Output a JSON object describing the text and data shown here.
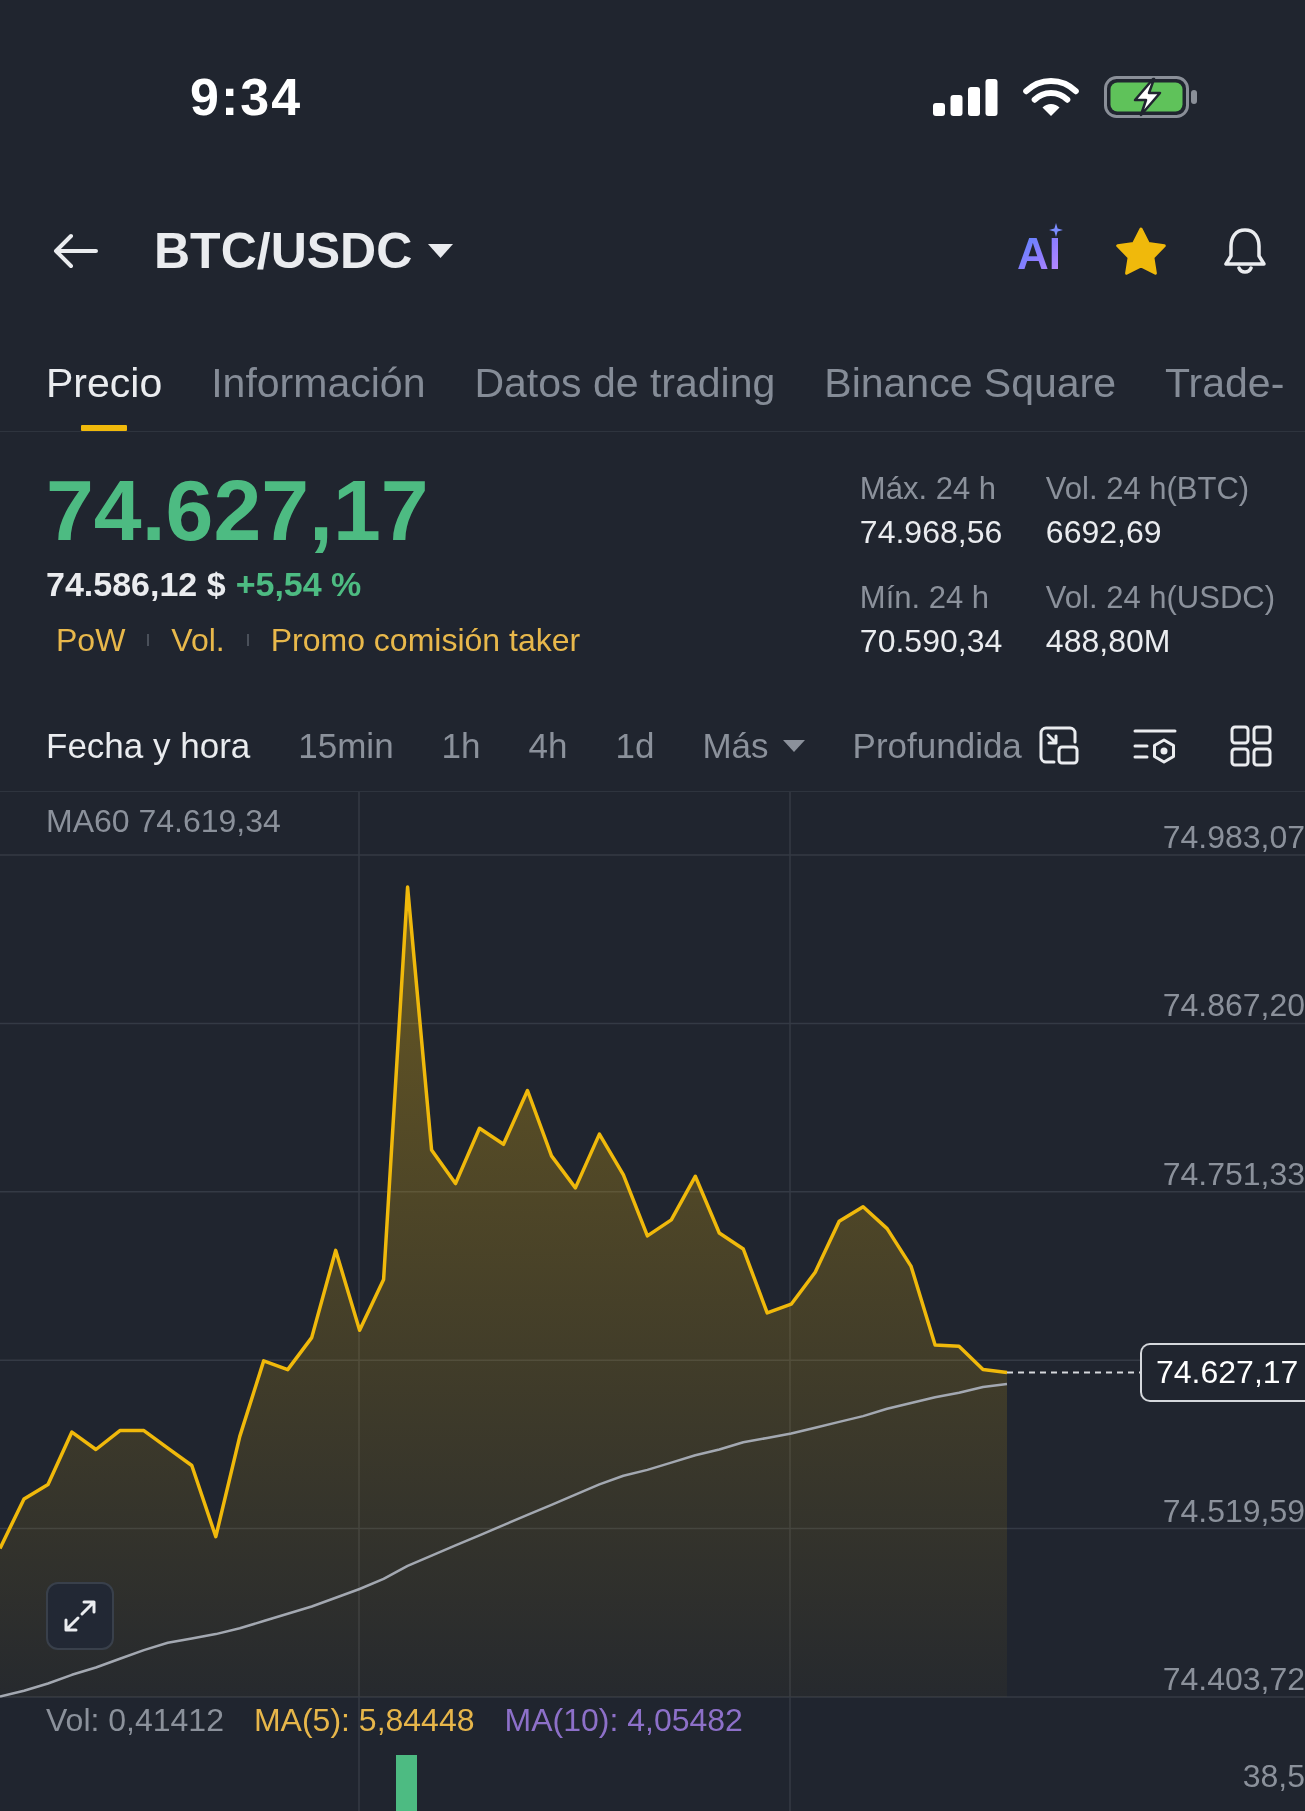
{
  "status_bar": {
    "time": "9:34"
  },
  "header": {
    "pair": "BTC/USDC",
    "ai_label": "AI",
    "favorite": true
  },
  "tabs": [
    {
      "label": "Precio",
      "selected": true
    },
    {
      "label": "Información",
      "selected": false
    },
    {
      "label": "Datos de trading",
      "selected": false
    },
    {
      "label": "Binance Square",
      "selected": false
    },
    {
      "label": "Trade-",
      "selected": false
    }
  ],
  "price": {
    "last": "74.627,17",
    "rising": true,
    "fiat": "74.586,12 $",
    "change": "+5,54 %",
    "tags": [
      "PoW",
      "Vol.",
      "Promo comisión taker"
    ]
  },
  "stats": [
    {
      "label": "Máx. 24 h",
      "value": "74.968,56"
    },
    {
      "label": "Vol. 24 h(BTC)",
      "value": "6692,69"
    },
    {
      "label": "Mín. 24 h",
      "value": "70.590,34"
    },
    {
      "label": "Vol. 24 h(USDC)",
      "value": "488,80M"
    }
  ],
  "intervals": [
    {
      "label": "Fecha y hora",
      "selected": true,
      "kind": "option"
    },
    {
      "label": "15min",
      "selected": false,
      "kind": "option"
    },
    {
      "label": "1h",
      "selected": false,
      "kind": "option"
    },
    {
      "label": "4h",
      "selected": false,
      "kind": "option"
    },
    {
      "label": "1d",
      "selected": false,
      "kind": "option"
    },
    {
      "label": "Más",
      "selected": false,
      "kind": "dropdown"
    },
    {
      "label": "Profundida",
      "selected": false,
      "kind": "option"
    }
  ],
  "chart": {
    "legend_value": "74.619,34",
    "current_price": "74.627,17",
    "chart_data": {
      "type": "area",
      "grid": true,
      "series": [
        {
          "type": "area",
          "color": "#f0b90b",
          "values": [
            74506,
            74540,
            74550,
            74586,
            74574,
            74587,
            74587,
            74575,
            74563,
            74514,
            74583,
            74635,
            74629,
            74651,
            74711,
            74656,
            74691,
            74961,
            74780,
            74757,
            74795,
            74784,
            74821,
            74776,
            74754,
            74791,
            74763,
            74721,
            74732,
            74762,
            74723,
            74712,
            74668,
            74674,
            74696,
            74731,
            74741,
            74726,
            74700,
            74646,
            74645,
            74629,
            74627
          ]
        },
        {
          "type": "line",
          "name": "MA60",
          "color": "#a3a8b1",
          "values": [
            74404,
            74408,
            74413,
            74419,
            74424,
            74430,
            74436,
            74441,
            74444,
            74447,
            74451,
            74456,
            74461,
            74466,
            74472,
            74478,
            74485,
            74494,
            74501,
            74508,
            74515,
            74522,
            74529,
            74536,
            74543,
            74550,
            74556,
            74560,
            74565,
            74570,
            74574,
            74579,
            74582,
            74585,
            74589,
            74593,
            74597,
            74602,
            74606,
            74610,
            74613,
            74617,
            74619
          ]
        }
      ],
      "ylim": [
        74403.72,
        75026.42
      ],
      "yticks": [
        {
          "value": 74983.07,
          "label": "74.983,07"
        },
        {
          "value": 74867.2,
          "label": "74.867,20"
        },
        {
          "value": 74751.33,
          "label": "74.751,33"
        },
        {
          "value": 74519.59,
          "label": "74.519,59"
        },
        {
          "value": 74403.72,
          "label": "74.403,72"
        }
      ]
    }
  },
  "volume": {
    "legend": [
      {
        "label": "Vol: 0,41412",
        "color": "#8b919b"
      },
      {
        "label": "MA(5): 5,84448",
        "color": "#e7b64a"
      },
      {
        "label": "MA(10): 4,05482",
        "color": "#8d70c9"
      }
    ],
    "axis_label": "38,5"
  }
}
